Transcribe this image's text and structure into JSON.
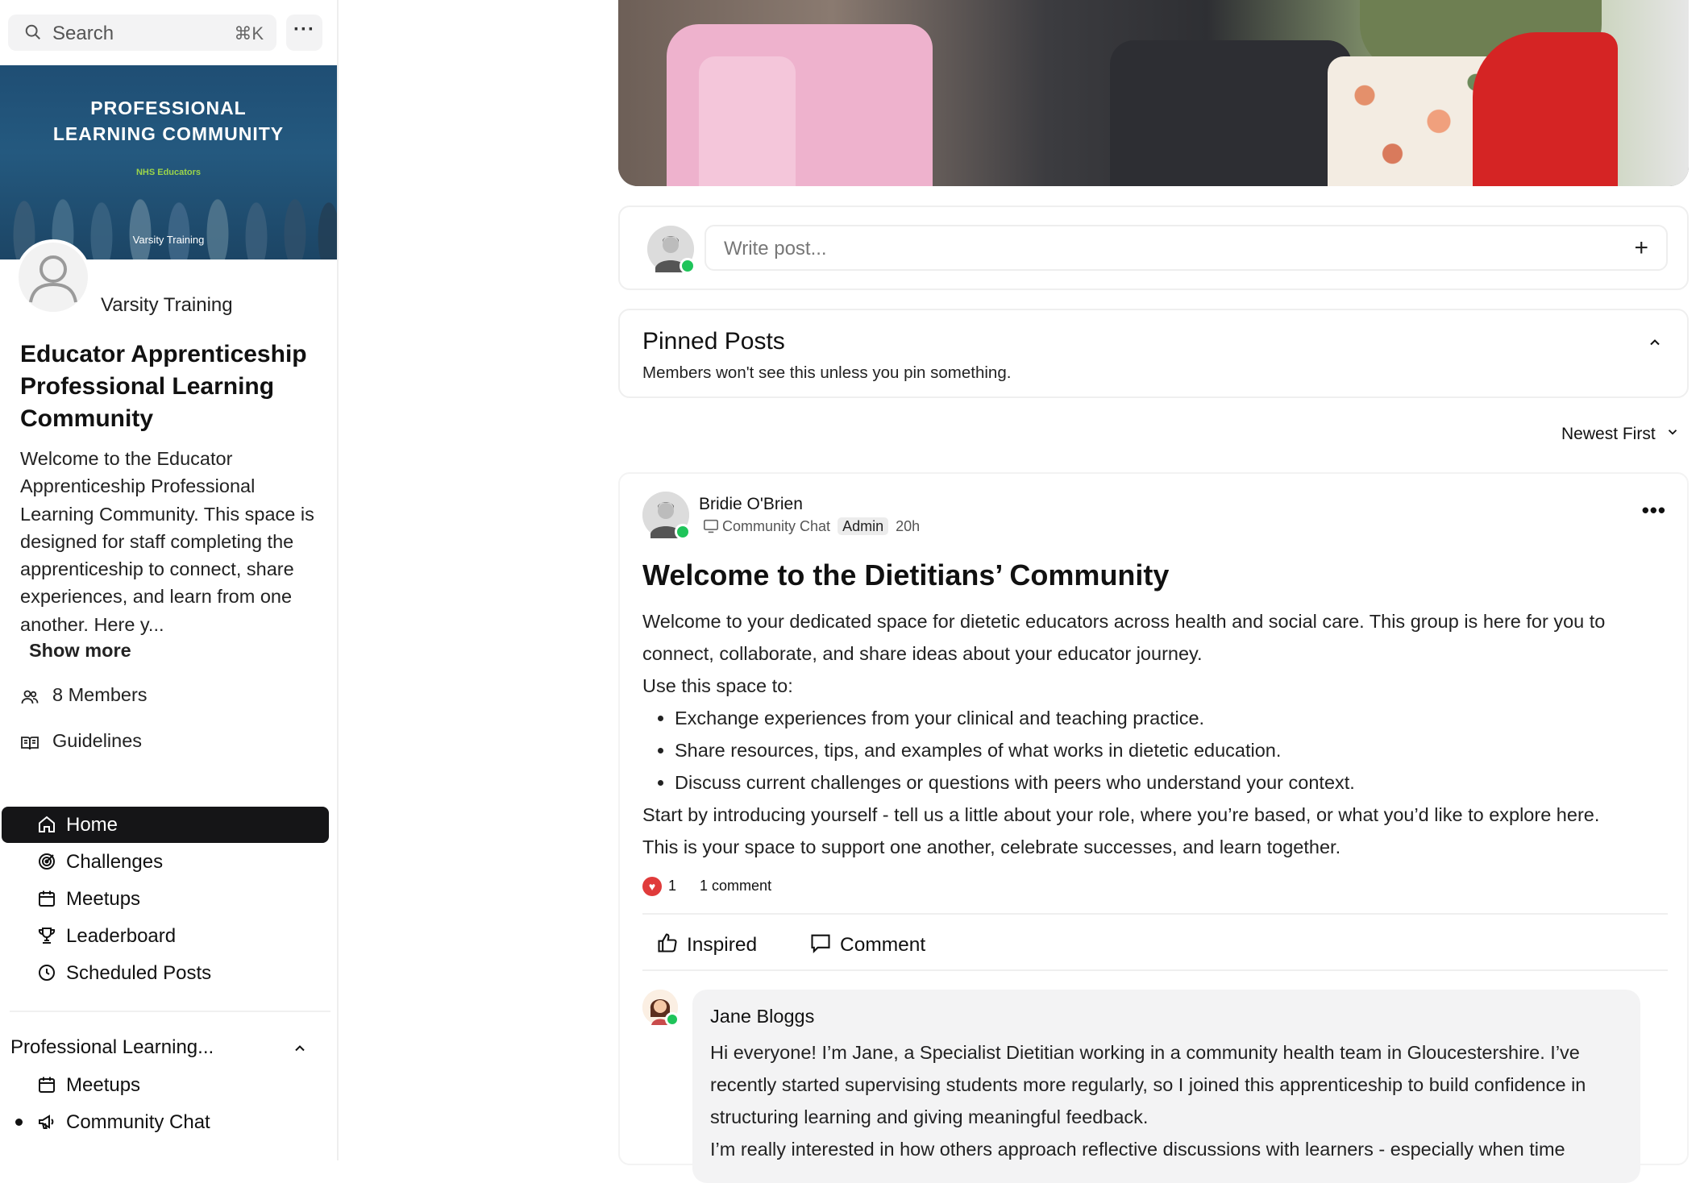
{
  "search": {
    "placeholder": "Search",
    "shortcut": "⌘K",
    "more": "···"
  },
  "banner": {
    "title": "PROFESSIONAL LEARNING COMMUNITY",
    "subtitle": "NHS Educators",
    "footer": "Varsity Training"
  },
  "community": {
    "owner": "Varsity Training",
    "title": "Educator Apprenticeship Professional Learning Community",
    "description": "Welcome to the Educator Apprenticeship Professional Learning Community. This space is designed for staff completing the apprenticeship to connect, share experiences, and learn from one another. Here y...",
    "show_more": "Show more",
    "members": "8 Members",
    "guidelines": "Guidelines"
  },
  "nav": {
    "items": [
      {
        "label": "Home",
        "icon": "home-icon",
        "active": true
      },
      {
        "label": "Challenges",
        "icon": "target-icon"
      },
      {
        "label": "Meetups",
        "icon": "calendar-icon"
      },
      {
        "label": "Leaderboard",
        "icon": "trophy-icon"
      },
      {
        "label": "Scheduled Posts",
        "icon": "clock-icon"
      }
    ],
    "section": {
      "label": "Professional Learning...",
      "items": [
        {
          "label": "Meetups",
          "icon": "calendar-icon"
        },
        {
          "label": "Community Chat",
          "icon": "megaphone-icon"
        }
      ]
    }
  },
  "composer": {
    "placeholder": "Write post...",
    "plus": "+"
  },
  "pinned": {
    "title": "Pinned Posts",
    "subtitle": "Members won't see this unless you pin something."
  },
  "sort": {
    "label": "Newest First"
  },
  "post": {
    "author": "Bridie O'Brien",
    "channel": "Community Chat",
    "badge": "Admin",
    "time": "20h",
    "title": "Welcome to the Dietitians’ Community",
    "intro": "Welcome to your dedicated space for dietetic educators across health and social care. This group is here for you to connect, collaborate, and share ideas about your educator journey.",
    "use_label": "Use this space to:",
    "bullets": [
      "Exchange experiences from your clinical and teaching practice.",
      "Share resources, tips, and examples of what works in dietetic education.",
      "Discuss current challenges or questions with peers who understand your context."
    ],
    "outro1": "Start by introducing yourself - tell us a little about your role, where you’re based, or what you’d like to explore here.",
    "outro2": "This is your space to support one another, celebrate successes, and learn together.",
    "reaction_count": "1",
    "comment_count": "1 comment",
    "inspired_label": "Inspired",
    "comment_label": "Comment"
  },
  "comment": {
    "author": "Jane Bloggs",
    "text1": "Hi everyone! I’m Jane, a Specialist Dietitian working in a community health team in Gloucestershire. I’ve recently started supervising students more regularly, so I joined this apprenticeship to build confidence in structuring learning and giving meaningful feedback.",
    "text2": "I’m really interested in how others approach reflective discussions with learners - especially when time"
  },
  "colors": {
    "accent": "#151517",
    "online": "#1fc45a",
    "heart": "#e03b3b",
    "banner": "#1f4e74"
  }
}
